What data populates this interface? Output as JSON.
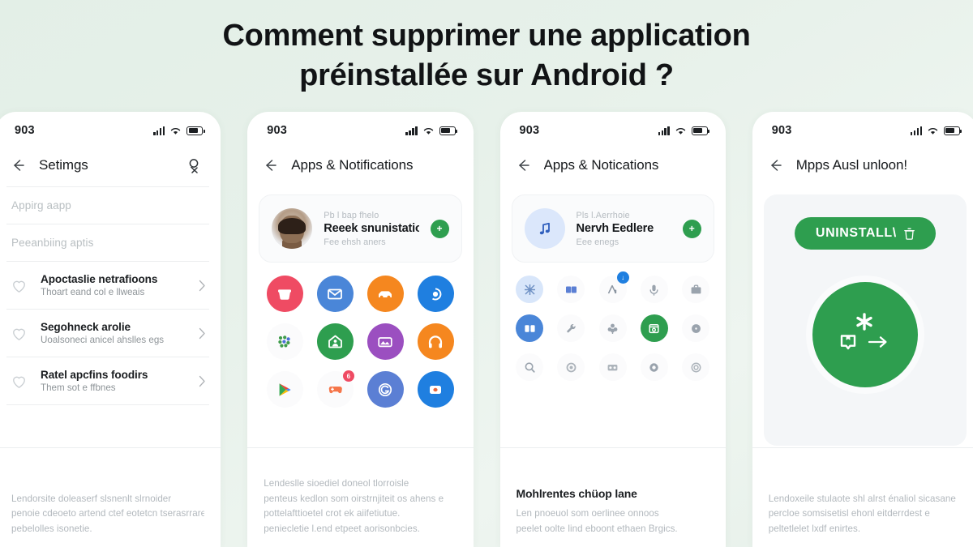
{
  "theme": {
    "background_from": "#e3efe7",
    "background_to": "#e6f0e9",
    "accent_green": "#2e9e4f",
    "text_dark": "#111315",
    "text_muted": "#b2b8bd"
  },
  "title": {
    "line1": "Comment supprimer une application",
    "line2": "préinstallée sur Android ?"
  },
  "panels": [
    {
      "status": {
        "time": "903",
        "signal": "signal-icon",
        "wifi": "wifi-icon",
        "battery": "battery-icon"
      },
      "appbar": {
        "back": "back-arrow-icon",
        "title": "Setimgs",
        "action": "search-icon"
      },
      "search_rows": [
        {
          "text": "Appirg aapp"
        },
        {
          "text": "Peeanbiing aptis"
        }
      ],
      "settings": [
        {
          "icon": "heart-outline-icon",
          "title": "Apoctaslie netrafioons",
          "sub": "Thoart eand col e llweais",
          "chevron": "chevron-right-icon"
        },
        {
          "icon": "heart-outline-icon",
          "title": "Segohneck arolie",
          "sub": "Uoalsoneci anicel ahslles egs",
          "chevron": "chevron-right-icon"
        },
        {
          "icon": "heart-outline-icon",
          "title": "Ratel apcfins foodirs",
          "sub": "Them sot e ffbnes",
          "chevron": "chevron-right-icon"
        }
      ],
      "caption": {
        "heading": "",
        "lines": [
          "Lendorsite doleaserf slsnenlt slrnoider",
          "penoie cdeoeto artend ctef eotetcn tserasrrare",
          "pebelolles isonetie."
        ]
      }
    },
    {
      "status": {
        "time": "903",
        "signal": "signal-icon",
        "wifi": "wifi-icon",
        "battery": "battery-icon"
      },
      "appbar": {
        "back": "back-arrow-icon",
        "title": "Apps & Notifications",
        "action": ""
      },
      "card": {
        "avatar": "user-photo-avatar",
        "eyebrow": "Pb l bap fhelo",
        "name": "Reeek snunistations",
        "sub": "Fee ehsh aners",
        "badge": "+"
      },
      "grid": {
        "columns": 4,
        "icons": [
          {
            "name": "mail-basket-icon",
            "bg": "#ef4b63",
            "fg": "#ffffff",
            "glyph": "basket"
          },
          {
            "name": "envelope-icon",
            "bg": "#4a86d8",
            "fg": "#ffffff",
            "glyph": "envelope"
          },
          {
            "name": "car-icon",
            "bg": "#f5871f",
            "fg": "#ffffff",
            "glyph": "car"
          },
          {
            "name": "camera-lens-icon",
            "bg": "#1f7fe0",
            "fg": "#ffffff",
            "glyph": "lens"
          },
          {
            "name": "app-cluster-icon",
            "bg": "#fbfbfc",
            "fg": "#3f9c4b",
            "glyph": "cluster"
          },
          {
            "name": "home-person-icon",
            "bg": "#2e9e4f",
            "fg": "#ffffff",
            "glyph": "homeperson"
          },
          {
            "name": "gallery-icon",
            "bg": "#9b4fc0",
            "fg": "#ffffff",
            "glyph": "gallery"
          },
          {
            "name": "headphones-icon",
            "bg": "#f5871f",
            "fg": "#ffffff",
            "glyph": "headphones"
          },
          {
            "name": "play-store-icon",
            "bg": "#fbfbfc",
            "fg": "#4a86d8",
            "glyph": "playstore"
          },
          {
            "name": "game-controller-icon",
            "bg": "#fbfbfc",
            "fg": "#f5764a",
            "glyph": "controller",
            "badge": {
              "text": "6",
              "color": "#ef4b63"
            }
          },
          {
            "name": "grammar-icon",
            "bg": "#5b7fd4",
            "fg": "#ffffff",
            "glyph": "gcircle"
          },
          {
            "name": "mask-icon",
            "bg": "#1f7fe0",
            "fg": "#ffffff",
            "glyph": "mask"
          }
        ]
      },
      "caption": {
        "heading": "",
        "lines": [
          "Lendeslle sioediel doneol tlorroisle",
          "penteus kedlon som oirstrnjiteit os ahens e",
          "pottelafttioetel crot ek aiifetiutue.",
          "peniecletie l.end etpeet aorisonbcies."
        ]
      }
    },
    {
      "status": {
        "time": "903",
        "signal": "signal-icon",
        "wifi": "wifi-icon",
        "battery": "battery-icon"
      },
      "appbar": {
        "back": "back-arrow-icon",
        "title": "Apps & Notications",
        "action": ""
      },
      "card": {
        "avatar": "music-note-avatar",
        "eyebrow": "Pls l.Aerrhoie",
        "name": "Nervh Eedlere",
        "sub": "Eee enegs",
        "badge": "+"
      },
      "grid": {
        "columns": 5,
        "icons": [
          {
            "name": "tangle-icon",
            "bg": "#d8e6fa",
            "fg": "#6f91c4",
            "glyph": "tangle"
          },
          {
            "name": "book-icon",
            "bg": "#fbfbfc",
            "fg": "#5b7fd4",
            "glyph": "book"
          },
          {
            "name": "download-app-icon",
            "bg": "#fbfbfc",
            "fg": "#8b95a1",
            "glyph": "dl",
            "badge": {
              "text": "↓",
              "color": "#1f7fe0"
            }
          },
          {
            "name": "microphone-icon",
            "bg": "#fbfbfc",
            "fg": "#9aa3ad",
            "glyph": "mic"
          },
          {
            "name": "briefcase-icon",
            "bg": "#fbfbfc",
            "fg": "#9aa3ad",
            "glyph": "briefcase"
          },
          {
            "name": "split-screen-icon",
            "bg": "#4a86d8",
            "fg": "#ffffff",
            "glyph": "split"
          },
          {
            "name": "wrench-icon",
            "bg": "#fbfbfc",
            "fg": "#9aa3ad",
            "glyph": "wrench"
          },
          {
            "name": "leaf-icon",
            "bg": "#fbfbfc",
            "fg": "#9aa3ad",
            "glyph": "leaf"
          },
          {
            "name": "install-box-icon",
            "bg": "#2e9e4f",
            "fg": "#ffffff",
            "glyph": "box"
          },
          {
            "name": "disc-icon",
            "bg": "#fbfbfc",
            "fg": "#9aa3ad",
            "glyph": "disc"
          },
          {
            "name": "search-circle-icon",
            "bg": "#fbfbfc",
            "fg": "#9aa3ad",
            "glyph": "search"
          },
          {
            "name": "ring-icon",
            "bg": "#fbfbfc",
            "fg": "#adb4bb",
            "glyph": "ring"
          },
          {
            "name": "dual-face-icon",
            "bg": "#fbfbfc",
            "fg": "#adb4bb",
            "glyph": "dual"
          },
          {
            "name": "aperture-icon",
            "bg": "#fbfbfc",
            "fg": "#9aa3ad",
            "glyph": "aperture"
          },
          {
            "name": "target-icon",
            "bg": "#fbfbfc",
            "fg": "#adb4bb",
            "glyph": "target"
          }
        ]
      },
      "caption": {
        "heading": "Mohlrentes chüop lane",
        "lines": [
          "Len pnoeuol som oerlinee onnoos",
          "peelet oolte lind eboont ethaen Brgics."
        ]
      }
    },
    {
      "status": {
        "time": "903",
        "signal": "signal-icon",
        "wifi": "wifi-icon",
        "battery": "battery-icon"
      },
      "appbar": {
        "back": "back-arrow-icon",
        "title": "Mpps Ausl unloon!",
        "action": ""
      },
      "stage": {
        "uninstall_label": "UNINSTALL\\",
        "uninstall_icon": "trash-icon",
        "orb": "green-orb-glyph"
      },
      "caption": {
        "heading": "",
        "lines": [
          "Lendoxeile stulaote shl alrst énaliol sicasane",
          "percloe somsisetisl ehonl eitderrdest e",
          "peltetlelet lxdf enirtes."
        ]
      }
    }
  ]
}
